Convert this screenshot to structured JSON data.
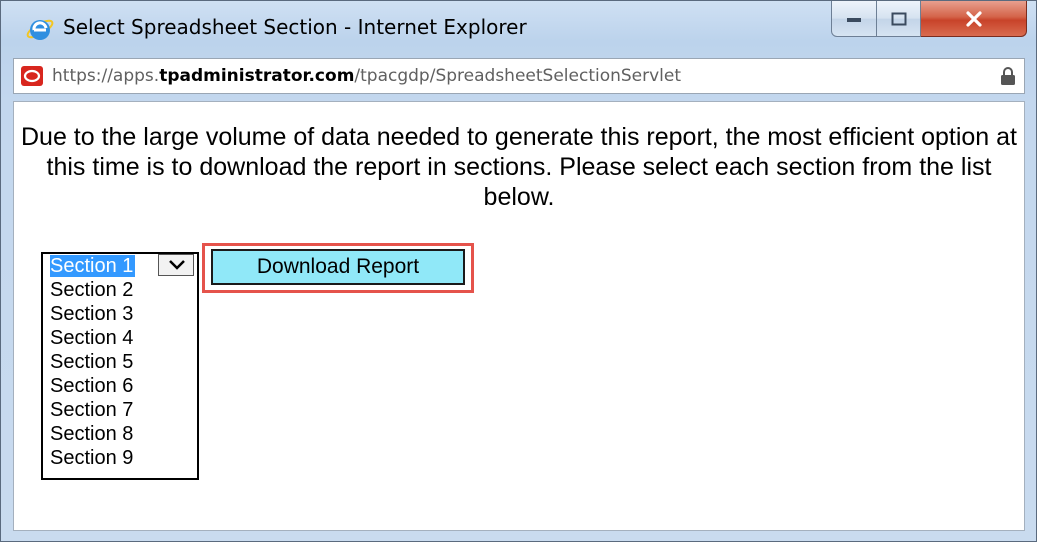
{
  "window": {
    "title": "Select Spreadsheet Section - Internet Explorer",
    "icon": "internet-explorer-icon",
    "controls": [
      "minimize-icon",
      "maximize-icon",
      "close-icon"
    ]
  },
  "address_bar": {
    "site_icon": "site-icon",
    "url_prefix": "https://apps.",
    "url_domain": "tpadministrator.com",
    "url_path": "/tpacgdp/SpreadsheetSelectionServlet",
    "lock_icon": "lock-icon"
  },
  "content": {
    "message": "Due to the large volume of data needed to generate this report, the most efficient option at this time is to download the report in sections. Please select each section from the list below.",
    "section_select": {
      "selected": "Section 1",
      "options": [
        "Section 1",
        "Section 2",
        "Section 3",
        "Section 4",
        "Section 5",
        "Section 6",
        "Section 7",
        "Section 8",
        "Section 9"
      ]
    },
    "download_button": "Download Report"
  },
  "colors": {
    "button_bg": "#90e8f8",
    "highlight_border": "#e5534b",
    "selection": "#3399ff"
  }
}
